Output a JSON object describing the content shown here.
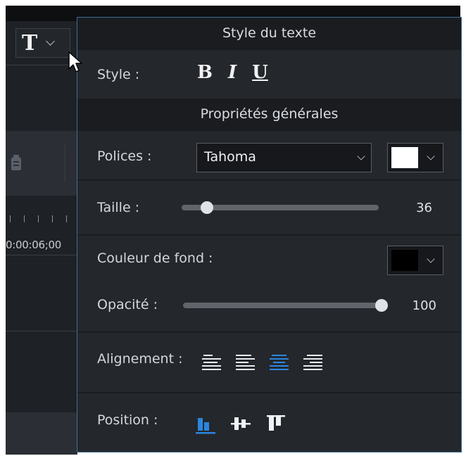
{
  "background": {
    "t_button": {
      "glyph": "T"
    },
    "timecode": "0:00:06;00"
  },
  "panel": {
    "header_text_style": "Style du texte",
    "style_label": "Style :",
    "style_buttons": {
      "bold": "B",
      "italic": "I",
      "underline": "U"
    },
    "header_general": "Propriétés générales",
    "font_label": "Polices :",
    "font_value": "Tahoma",
    "font_color": "#ffffff",
    "size_label": "Taille :",
    "size_value": "36",
    "size_fraction": 0.13,
    "bg_color_label": "Couleur de fond :",
    "bg_color": "#000000",
    "opacity_label": "Opacité :",
    "opacity_value": "100",
    "opacity_fraction": 1.0,
    "alignment_label": "Alignement :",
    "alignment_options": [
      "align-justify-icon",
      "align-left-icon",
      "align-center-icon",
      "align-right-icon"
    ],
    "alignment_selected": "align-center-icon",
    "position_label": "Position :",
    "position_options": [
      "position-bottom-icon",
      "position-middle-icon",
      "position-top-icon"
    ],
    "position_selected": "position-bottom-icon",
    "colors": {
      "accent": "#2a86e0",
      "panel_bg": "#24272c",
      "header_bg": "#1a1c20",
      "border": "#3f6f96"
    }
  }
}
